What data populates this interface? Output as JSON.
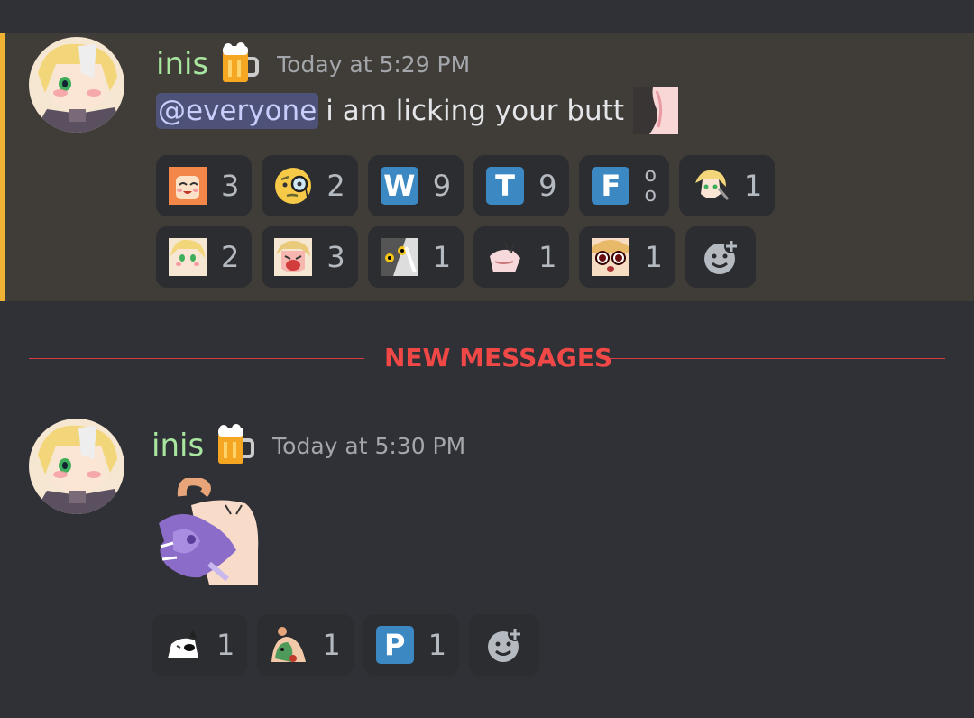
{
  "divider": {
    "label": "NEW MESSAGES"
  },
  "messages": [
    {
      "author": "inis",
      "timestamp": "Today at 5:29 PM",
      "role_icon": "beer-mug-icon",
      "mention": "@everyone",
      "text": "i am licking your butt",
      "inline_emoji": "custom-emoji",
      "reactions_row1": [
        {
          "emoji": "anime-girl-laughing-emoji",
          "count": "3"
        },
        {
          "emoji": "monocle-face-emoji",
          "count": "2"
        },
        {
          "emoji": "regional-w-emoji",
          "letter": "W",
          "count": "9"
        },
        {
          "emoji": "regional-t-emoji",
          "letter": "T",
          "count": "9"
        },
        {
          "emoji": "regional-f-emoji",
          "letter": "F",
          "count": "o",
          "count2": "o"
        },
        {
          "emoji": "anime-blonde-emoji",
          "count": "1"
        }
      ],
      "reactions_row2": [
        {
          "emoji": "anime-blonde-smile-emoji",
          "count": "2"
        },
        {
          "emoji": "anime-crying-emoji",
          "count": "3"
        },
        {
          "emoji": "cat-glitch-emoji",
          "count": "1"
        },
        {
          "emoji": "hand-emoji",
          "count": "1"
        },
        {
          "emoji": "shocked-face-emoji",
          "count": "1"
        }
      ]
    },
    {
      "author": "inis",
      "timestamp": "Today at 5:30 PM",
      "role_icon": "beer-mug-icon",
      "sticker": "purple-creature-sticker",
      "reactions": [
        {
          "emoji": "cat-eyepatch-emoji",
          "count": "1"
        },
        {
          "emoji": "frog-hug-emoji",
          "count": "1"
        },
        {
          "emoji": "regional-p-emoji",
          "letter": "P",
          "count": "1"
        }
      ]
    }
  ],
  "colors": {
    "background": "#303136",
    "highlight": "#403d38",
    "highlight_bar": "#f0b232",
    "username": "#a8e6a0",
    "divider": "#f04747",
    "mention_bg": "#4e5178",
    "reaction_bg": "#2b2d31"
  }
}
